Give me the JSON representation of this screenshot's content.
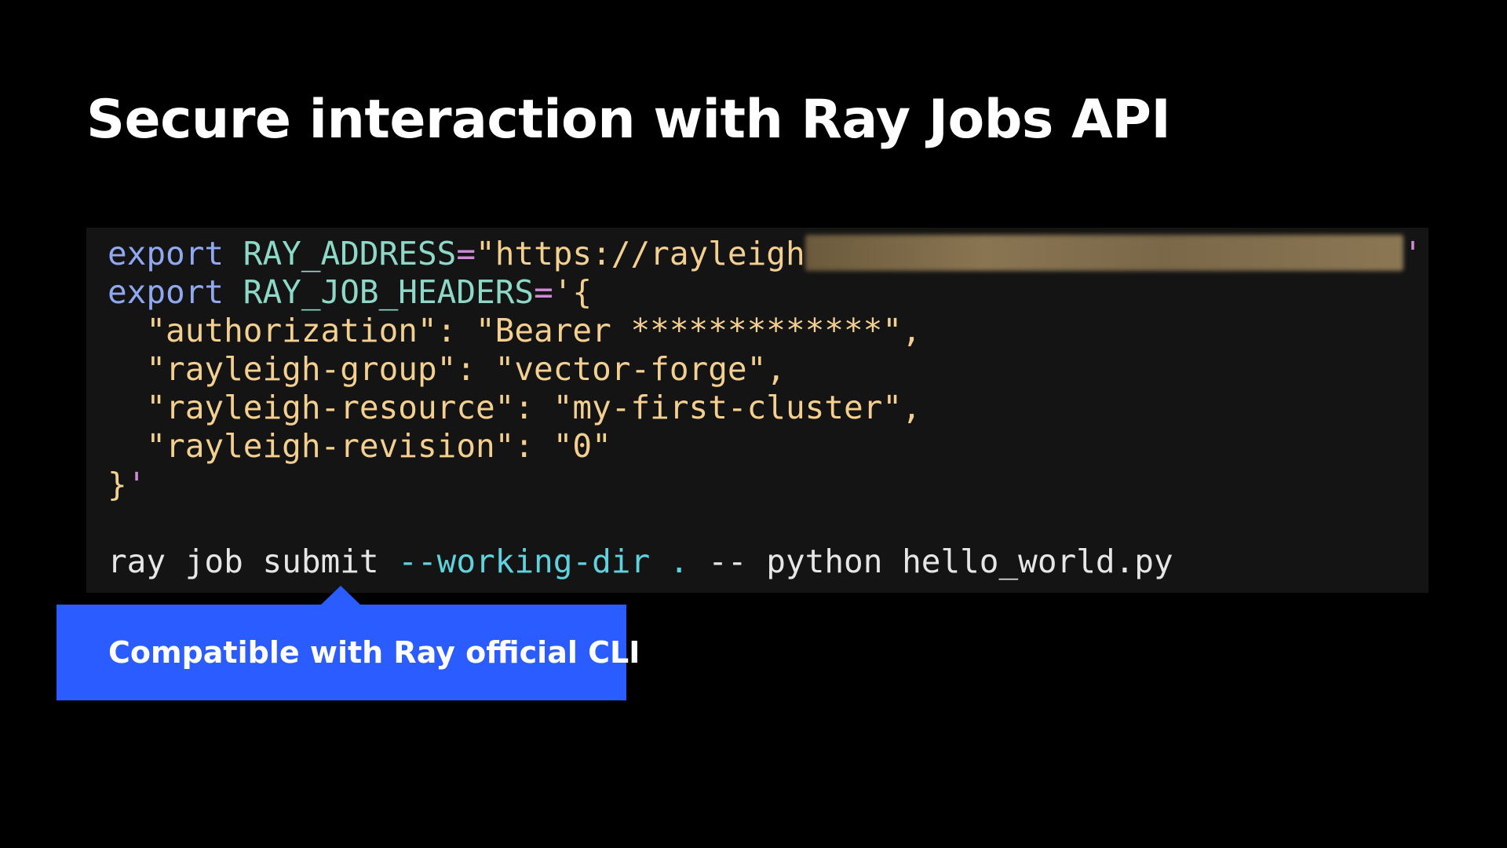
{
  "slide": {
    "title": "Secure interaction with Ray Jobs API"
  },
  "code": {
    "line1": {
      "keyword": "export",
      "variable": "RAY_ADDRESS",
      "equals": "=",
      "value_start": "\"https://rayleigh",
      "value_end": "'"
    },
    "line2": {
      "keyword": "export",
      "variable": "RAY_JOB_HEADERS",
      "equals": "=",
      "value": "'{"
    },
    "line3": "  \"authorization\": \"Bearer *************\",",
    "line4": "  \"rayleigh-group\": \"vector-forge\",",
    "line5": "  \"rayleigh-resource\": \"my-first-cluster\",",
    "line6": "  \"rayleigh-revision\": \"0\"",
    "line7": {
      "brace": "}",
      "quote": "'"
    },
    "command": {
      "base": "ray job submit ",
      "flag": "--working-dir",
      "dot": " . ",
      "rest": "-- python hello_world.py"
    }
  },
  "callout": {
    "text": "Compatible with Ray official CLI"
  },
  "colors": {
    "background": "#000000",
    "code_background": "#141414",
    "keyword": "#8fa8f0",
    "variable": "#8ed8c8",
    "string": "#f3cf90",
    "flag": "#5fd3dd",
    "callout": "#2b5cff"
  }
}
